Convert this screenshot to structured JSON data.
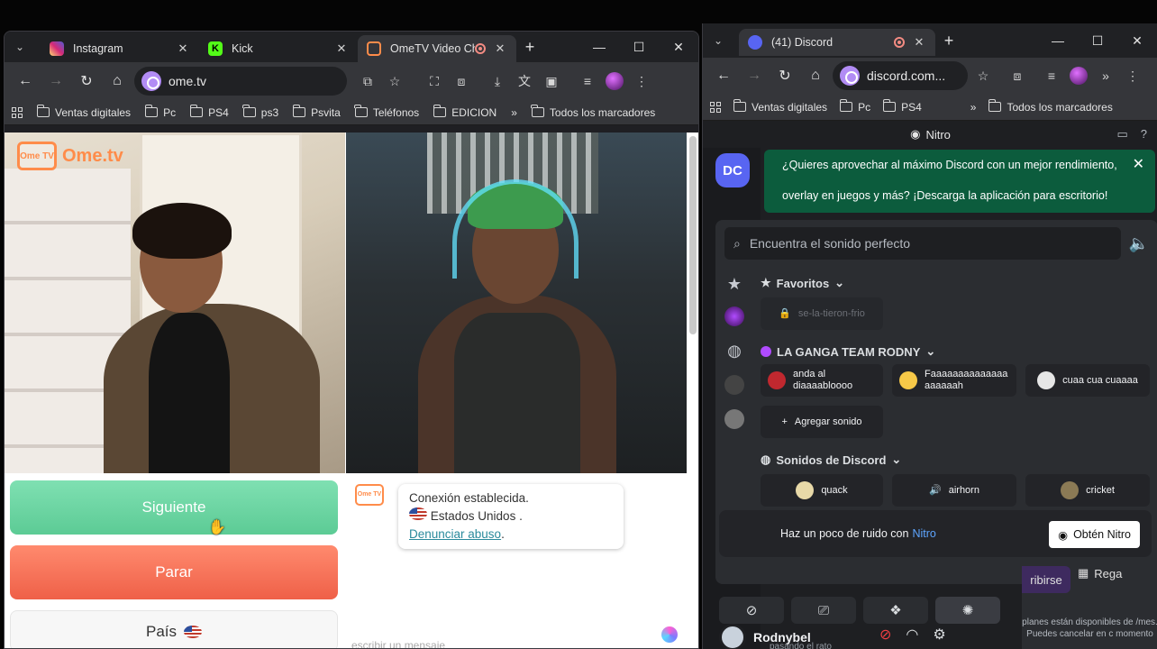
{
  "left_window": {
    "tabs": [
      {
        "label": "Instagram",
        "color": "#d62976"
      },
      {
        "label": "Kick",
        "color": "#53fc18"
      },
      {
        "label": "OmeTV Video Ch",
        "color": "#ff8c4a"
      }
    ],
    "url": "ome.tv",
    "bookmarks": [
      "Ventas digitales",
      "Pc",
      "PS4",
      "ps3",
      "Psvita",
      "Teléfonos",
      "EDICION"
    ],
    "all_bookmarks": "Todos los marcadores"
  },
  "ome": {
    "logo_badge": "Ome TV",
    "logo_text": "Ome.tv",
    "next_label": "Siguiente",
    "stop_label": "Parar",
    "country_label": "País",
    "chat": {
      "line1": "Conexión establecida.",
      "line2": "Estados Unidos .",
      "link": "Denunciar abuso",
      "link_suffix": ".",
      "input_placeholder": "escribir un mensaje"
    }
  },
  "right_window": {
    "tab": {
      "label": "(41) Discord",
      "color": "#5865f2"
    },
    "url": "discord.com...",
    "bookmarks": [
      "Ventas digitales",
      "Pc",
      "PS4"
    ],
    "all_bookmarks": "Todos los marcadores"
  },
  "discord": {
    "top_title": "Nitro",
    "home_label": "DC",
    "banner_line1": "¿Quieres aprovechar al máximo Discord con un mejor rendimiento,",
    "banner_line2": "overlay en juegos y más? ¡Descarga la aplicación para escritorio!",
    "search_placeholder": "Encuentra el sonido perfecto",
    "favorites_label": "Favoritos",
    "favorite_locked": "se-la-tieron-frio",
    "server_section": "LA GANGA TEAM RODNY",
    "server_sounds": [
      "anda al diaaaabloooo",
      "Faaaaaaaaaaaaaa aaaaaah",
      "cuaa cua cuaaaa"
    ],
    "add_sound": "Agregar sonido",
    "discord_section": "Sonidos de Discord",
    "discord_sounds": [
      "quack",
      "airhorn",
      "cricket"
    ],
    "nitro_prompt": "Haz un poco de ruido con",
    "nitro_word": "Nitro",
    "nitro_button": "Obtén Nitro",
    "username": "Rodnybel",
    "user_status": "pasando el rato",
    "overlap_btn": "ribirse",
    "overlap_btn2": "Rega",
    "overlap_text": "planes están disponibles de /mes. Puedes cancelar en c momento"
  }
}
